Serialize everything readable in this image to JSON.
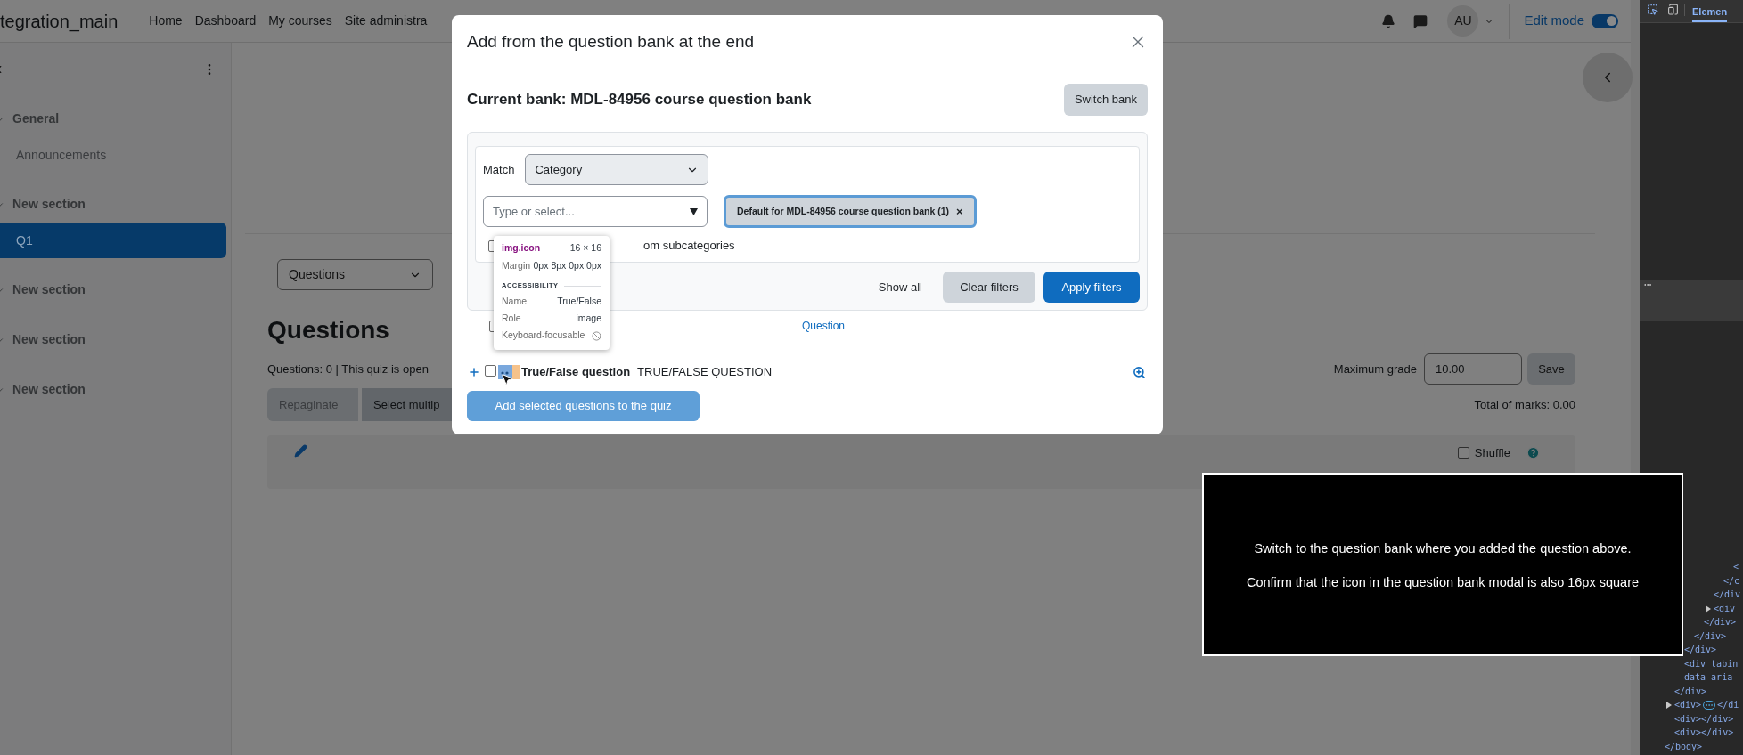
{
  "header": {
    "site_name": "tegration_main",
    "nav": [
      "Home",
      "Dashboard",
      "My courses",
      "Site administra"
    ],
    "avatar": "AU",
    "edit_mode": {
      "label": "Edit mode",
      "on": true
    }
  },
  "sidebar": {
    "items": [
      {
        "kind": "section",
        "label": "General"
      },
      {
        "kind": "activity",
        "label": "Announcements",
        "selected": false
      },
      {
        "kind": "section",
        "label": "New section"
      },
      {
        "kind": "activity",
        "label": "Q1",
        "selected": true
      },
      {
        "kind": "section",
        "label": "New section"
      },
      {
        "kind": "section",
        "label": "New section"
      },
      {
        "kind": "section",
        "label": "New section"
      }
    ]
  },
  "page": {
    "view_select": "Questions",
    "heading": "Questions",
    "summary": "Questions: 0 | This quiz is open",
    "buttons": [
      "Repaginate",
      "Select multip"
    ],
    "max_grade": {
      "label": "Maximum grade",
      "value": "10.00",
      "button": "Save"
    },
    "total_marks": "Total of marks: 0.00",
    "shuffle": {
      "label": "Shuffle",
      "checked": false
    }
  },
  "modal": {
    "title": "Add from the question bank at the end",
    "current_bank": "Current bank: MDL-84956 course question bank",
    "switch_button": "Switch bank",
    "filter": {
      "match_label": "Match",
      "match_value": "Category",
      "search_placeholder": "Type or select...",
      "chip": "Default for MDL-84956 course question bank (1)",
      "chip_remove": "×",
      "subcategories": {
        "label": "om subcategories",
        "checked": false
      },
      "show_all": "Show all",
      "clear_button": "Clear filters",
      "apply_button": "Apply filters"
    },
    "table": {
      "select_all_checked": false,
      "column": "Question",
      "rows": [
        {
          "checked": false,
          "type": "True/False question",
          "text": "TRUE/FALSE QUESTION"
        }
      ]
    },
    "add_button": {
      "label": "Add selected questions to the quiz",
      "disabled": true
    }
  },
  "inspector_tooltip": {
    "selector": "img.icon",
    "size": "16 × 16",
    "margin_label": "Margin",
    "margin_value": "0px 8px 0px 0px",
    "section": "ACCESSIBILITY",
    "rows": [
      {
        "kind": "text",
        "label": "Name",
        "value": "True/False"
      },
      {
        "kind": "text",
        "label": "Role",
        "value": "image"
      },
      {
        "kind": "blocked",
        "label": "Keyboard-focusable"
      }
    ]
  },
  "devtools": {
    "tab": "Elemen",
    "tree": [
      {
        "children": [
          {
            "children": [
              {
                "children": [
                  {
                    "children": [
                      {
                        "children": [
                          {
                            "children": [
                              {
                                "children": [
                                  {
                                    "text": "<",
                                    "expandable": false
                                  }
                                ]
                              },
                              {
                                "text": "</c",
                                "expandable": false
                              }
                            ]
                          },
                          {
                            "text": "</div",
                            "expandable": false
                          },
                          {
                            "text": "<div",
                            "expandable": true
                          }
                        ]
                      },
                      {
                        "text": "</div>",
                        "expandable": false
                      }
                    ]
                  },
                  {
                    "text": "</div>",
                    "expandable": false
                  }
                ]
              },
              {
                "text": "</div>",
                "expandable": false
              },
              {
                "text": "<div tabin",
                "expandable": false
              },
              {
                "text": "data-aria-",
                "expandable": false
              }
            ]
          },
          {
            "text": "</div>",
            "expandable": false
          },
          {
            "text": "<div>",
            "expandable": true,
            "tail": "</di"
          },
          {
            "text": "<div></div>",
            "expandable": false
          },
          {
            "text": "<div></div>",
            "expandable": false
          }
        ]
      },
      {
        "text": "</body>",
        "expandable": false
      }
    ]
  },
  "instructions": [
    "Switch to the question bank where you added the question above.",
    "Confirm that the icon in the question bank modal is also 16px square"
  ]
}
